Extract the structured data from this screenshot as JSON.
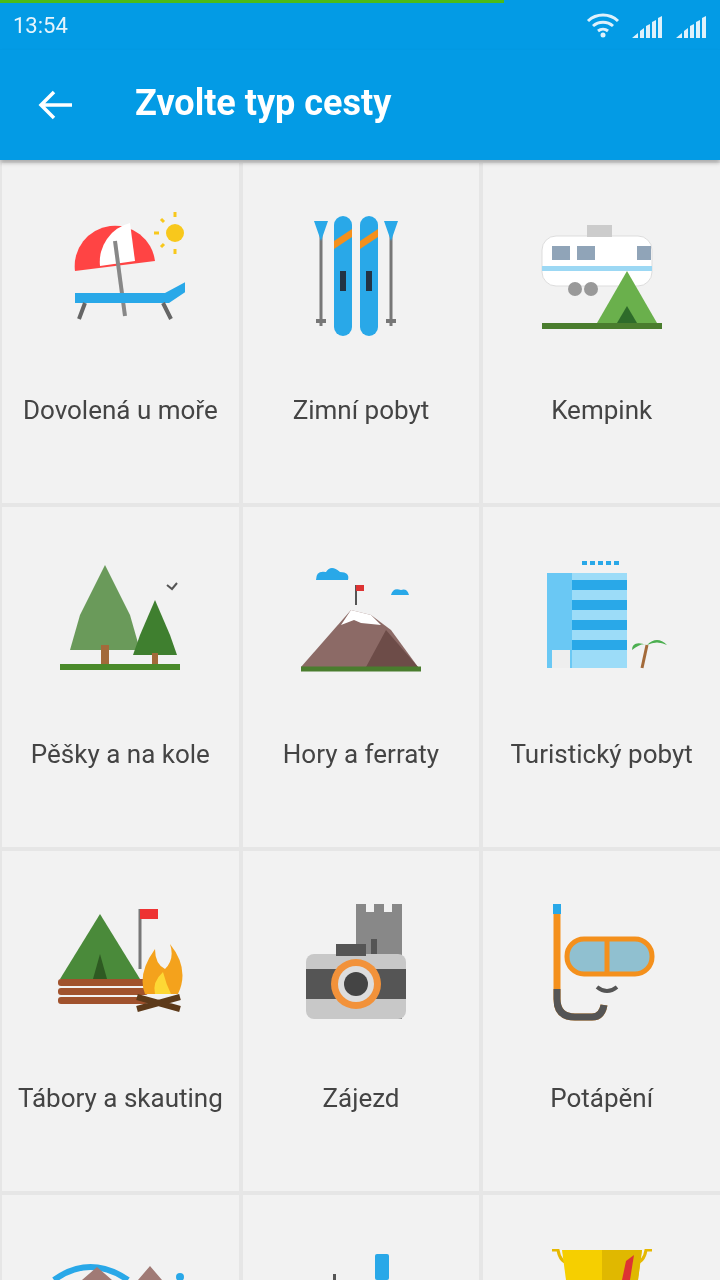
{
  "status_bar": {
    "time": "13:54",
    "progress": {
      "level": 0.7
    }
  },
  "app_bar": {
    "title": "Zvolte typ cesty"
  },
  "trip_types": [
    {
      "label": "Dovolená u moře"
    },
    {
      "label": "Zimní pobyt"
    },
    {
      "label": "Kempink"
    },
    {
      "label": "Pěšky a na kole"
    },
    {
      "label": "Hory a ferraty"
    },
    {
      "label": "Turistický pobyt"
    },
    {
      "label": "Tábory a skauting"
    },
    {
      "label": "Zájezd"
    },
    {
      "label": "Potápění"
    },
    {
      "kind": "partial"
    },
    {
      "kind": "partial"
    },
    {
      "kind": "partial"
    }
  ]
}
